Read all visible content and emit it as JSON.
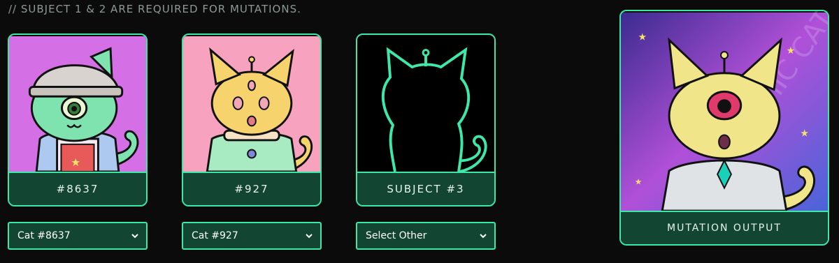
{
  "instructions": "// SUBJECT 1 & 2 ARE REQUIRED FOR MUTATIONS.",
  "subjects": [
    {
      "label": "#8637",
      "selected": "Cat #8637",
      "bg": "#d46fe6"
    },
    {
      "label": "#927",
      "selected": "Cat #927",
      "bg": "#f7a3c0"
    },
    {
      "label": "SUBJECT #3",
      "selected": "Select Other",
      "bg": "#000000"
    }
  ],
  "output": {
    "label": "MUTATION OUTPUT",
    "watermark": "COSMIC CATS"
  },
  "colors": {
    "accent": "#3ee8a8",
    "panel": "#124632",
    "background": "#0b0b0c"
  }
}
